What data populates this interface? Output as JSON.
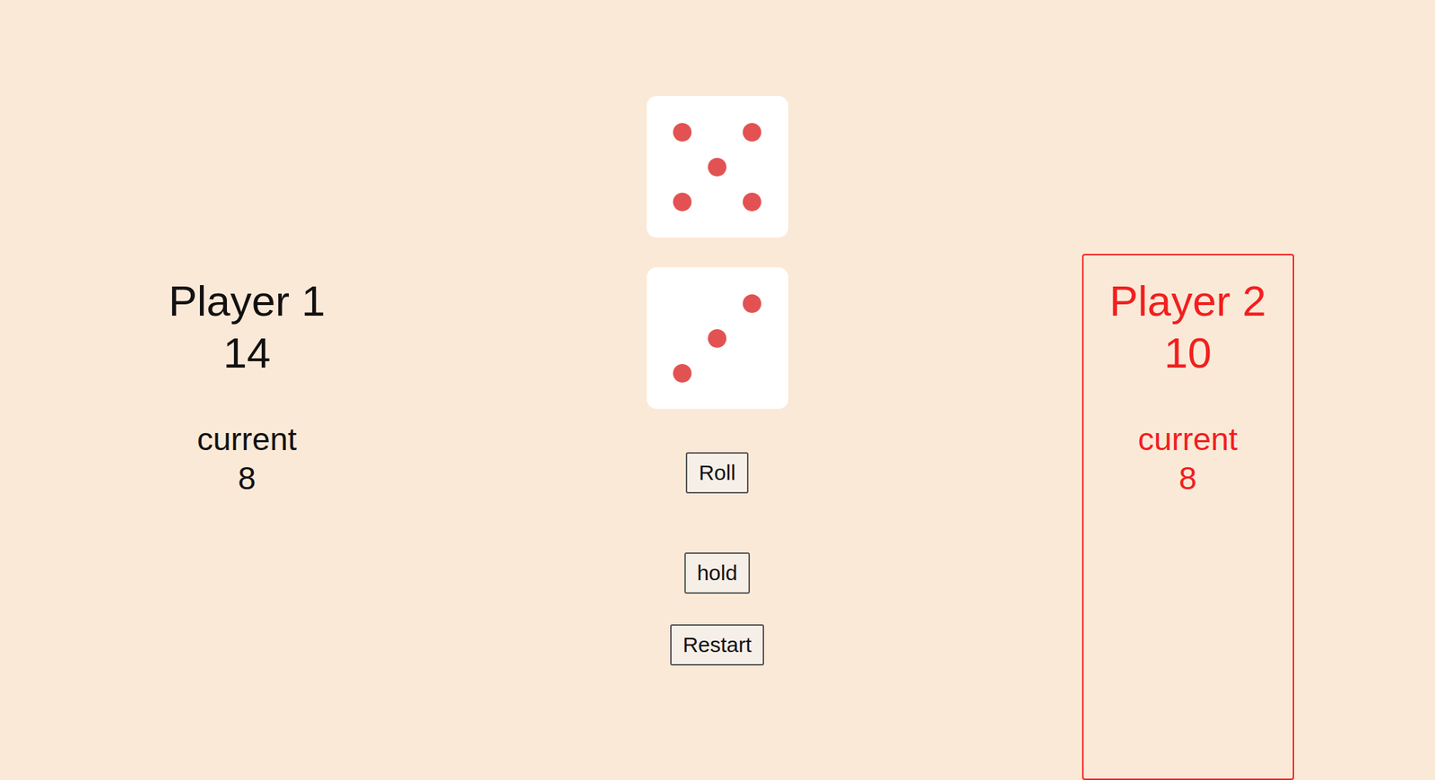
{
  "players": [
    {
      "name": "Player 1",
      "score": "14",
      "current_label": "current",
      "current": "8",
      "selected": false
    },
    {
      "name": "Player 2",
      "score": "10",
      "current_label": "current",
      "current": "8",
      "selected": true
    }
  ],
  "dice": [
    {
      "pips": 5
    },
    {
      "pips": 3
    }
  ],
  "buttons": [
    "Roll",
    "hold",
    "Restart"
  ]
}
